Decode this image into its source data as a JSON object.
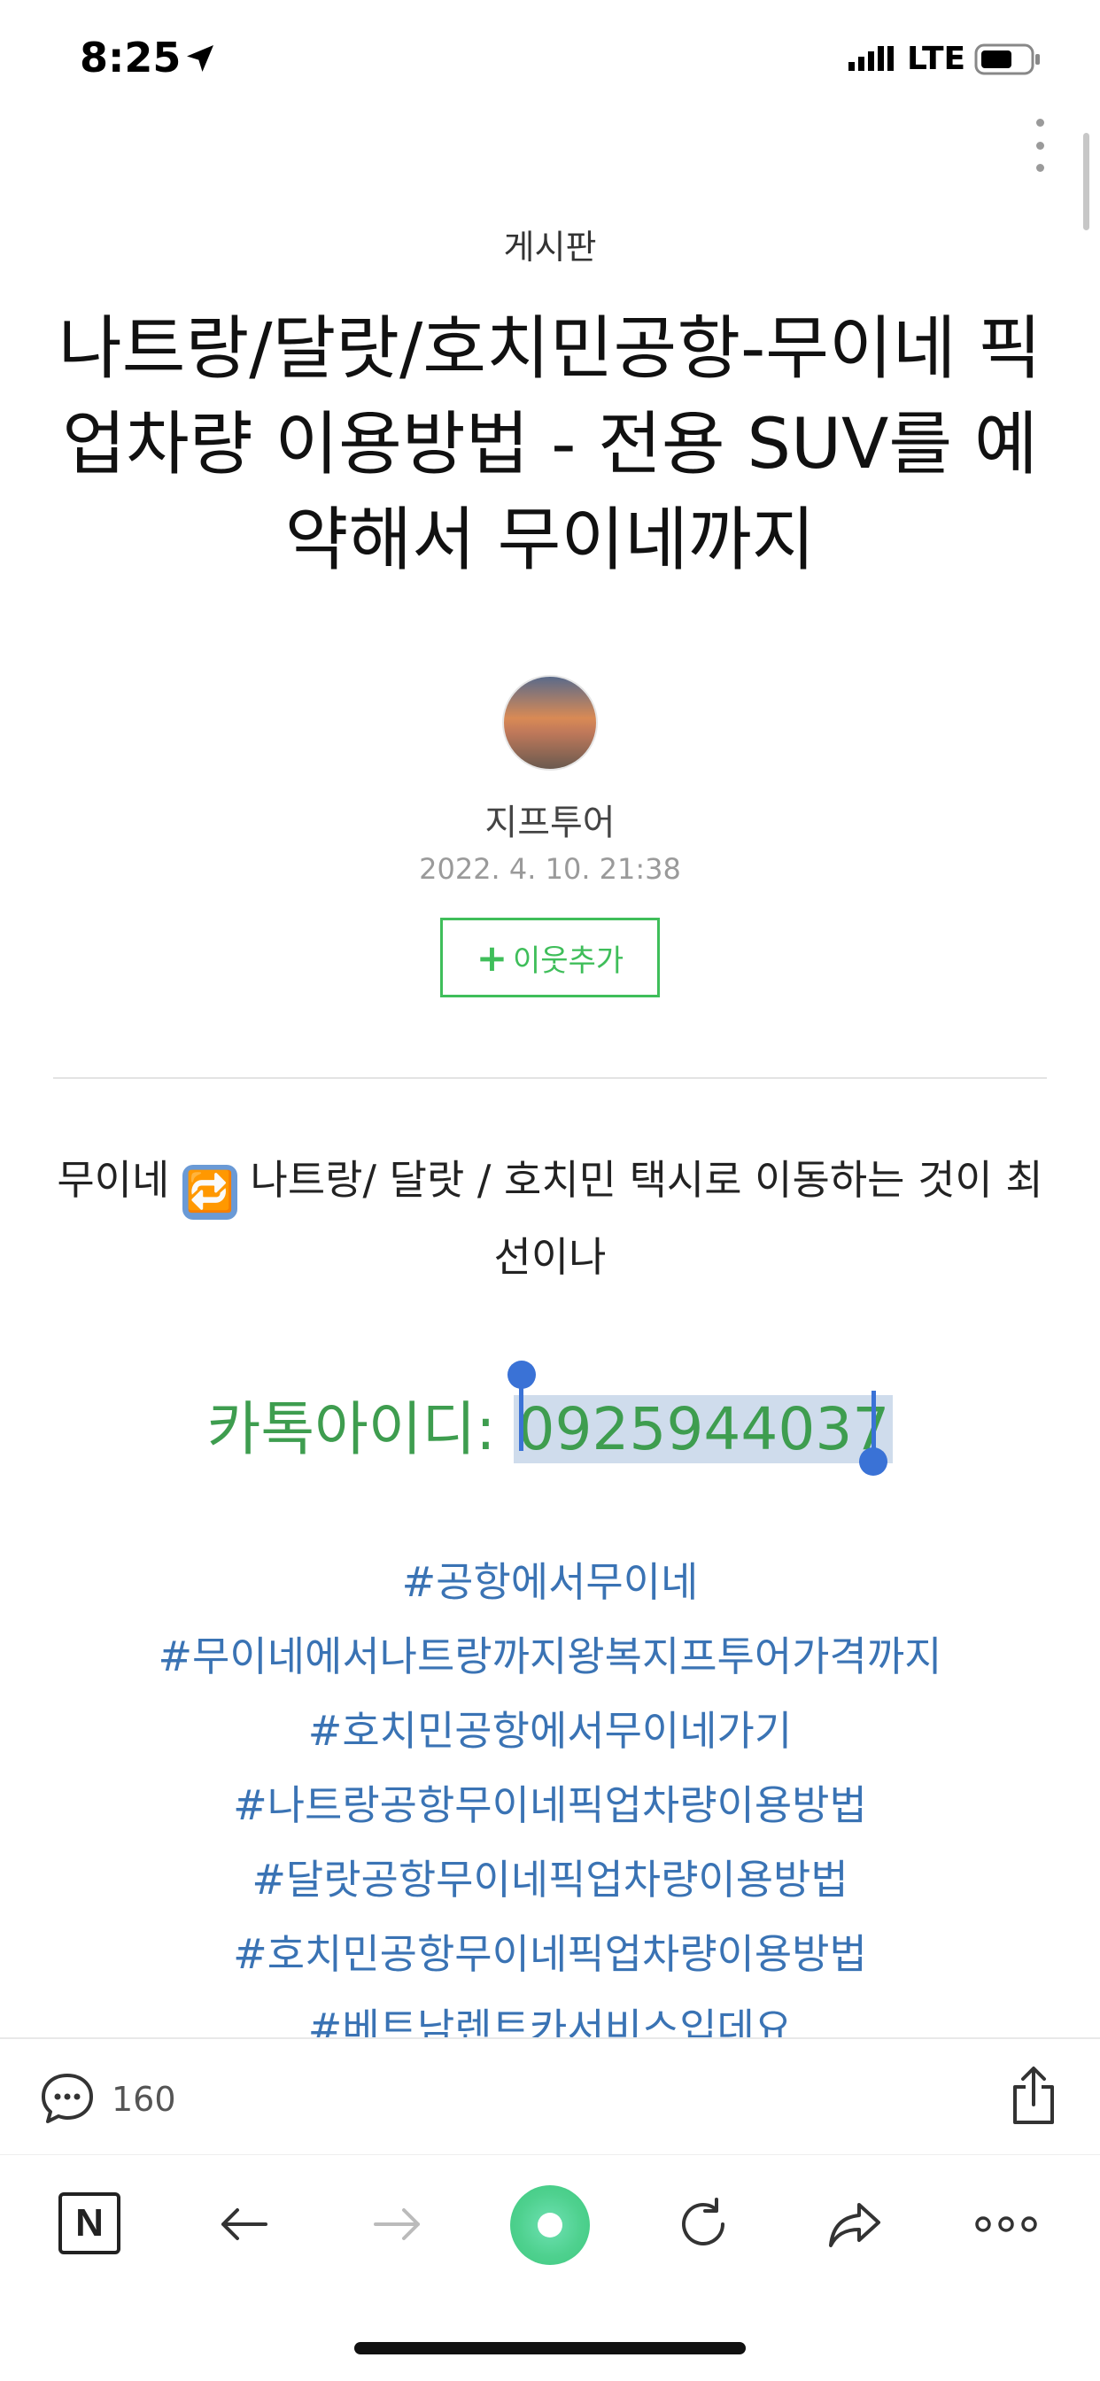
{
  "status_bar": {
    "time": "8:25",
    "network": "LTE"
  },
  "post": {
    "category": "게시판",
    "title": "나트랑/달랏/호치민공항-무이네 픽업차량 이용방법 - 전용 SUV를 예약해서 무이네까지",
    "author": "지프투어",
    "date": "2022. 4. 10. 21:38",
    "follow_label": "이웃추가",
    "follow_plus": "+",
    "body_part1": "무이네",
    "body_emoji": "🔁",
    "body_part2": "나트랑/ 달랏 / 호치민 택시로 이동하는 것이 최선이나",
    "kakao_label": "카톡아이디: ",
    "kakao_id": "0925944037",
    "tags": [
      "#공항에서무이네",
      "#무이네에서나트랑까지왕복지프투어가격까지",
      "#호치민공항에서무이네가기",
      "#나트랑공항무이네픽업차량이용방법",
      "#달랏공항무이네픽업차량이용방법",
      "#호치민공항무이네픽업차량이용방법",
      "#베트남렌트카서비스입데요"
    ]
  },
  "comments": {
    "count": "160"
  },
  "toolbar": {
    "n_label": "N"
  },
  "colors": {
    "accent_green": "#3fbe5a",
    "kakao_green": "#3e9d4f",
    "tag_blue": "#3a73b4",
    "selection_blue": "#3a72d6"
  },
  "icons": [
    "location-arrow-icon",
    "signal-icon",
    "battery-icon",
    "more-vertical-icon",
    "comment-icon",
    "share-icon",
    "naver-n-icon",
    "back-arrow-icon",
    "forward-arrow-icon",
    "green-dot-icon",
    "reload-icon",
    "share-forward-icon",
    "more-horizontal-icon"
  ]
}
